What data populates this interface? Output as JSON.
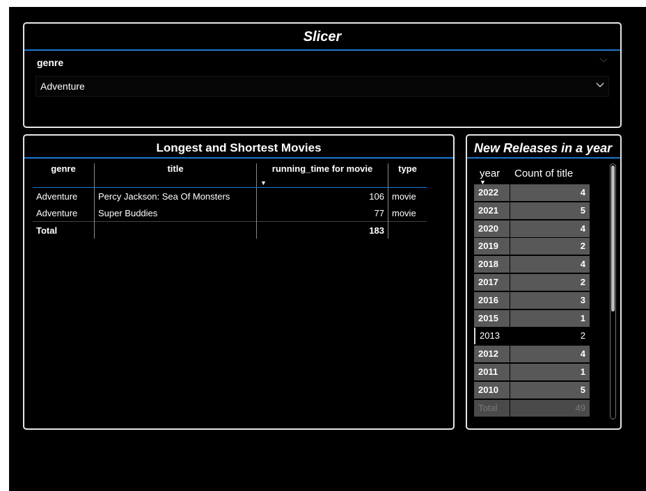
{
  "slicer": {
    "title": "Slicer",
    "field": "genre",
    "selected": "Adventure"
  },
  "movies_table": {
    "title": "Longest and Shortest Movies",
    "columns": [
      "genre",
      "title",
      "running_time for movie",
      "type"
    ],
    "rows": [
      {
        "genre": "Adventure",
        "title": "Percy Jackson: Sea Of Monsters",
        "running_time": "106",
        "type": "movie"
      },
      {
        "genre": "Adventure",
        "title": "Super Buddies",
        "running_time": "77",
        "type": "movie"
      }
    ],
    "total": {
      "label": "Total",
      "running_time": "183"
    }
  },
  "releases": {
    "title": "New Releases in a year",
    "columns": [
      "year",
      "Count of title"
    ],
    "rows": [
      {
        "year": "2022",
        "count": "4"
      },
      {
        "year": "2021",
        "count": "5"
      },
      {
        "year": "2020",
        "count": "4"
      },
      {
        "year": "2019",
        "count": "2"
      },
      {
        "year": "2018",
        "count": "4"
      },
      {
        "year": "2017",
        "count": "2"
      },
      {
        "year": "2016",
        "count": "3"
      },
      {
        "year": "2015",
        "count": "1"
      },
      {
        "year": "2013",
        "count": "2"
      },
      {
        "year": "2012",
        "count": "4"
      },
      {
        "year": "2011",
        "count": "1"
      },
      {
        "year": "2010",
        "count": "5"
      }
    ],
    "selected_year": "2013",
    "total": {
      "label": "Total",
      "count": "49"
    }
  },
  "colors": {
    "accent": "#1c78d4",
    "background": "#000000",
    "row_fill": "#585858"
  }
}
